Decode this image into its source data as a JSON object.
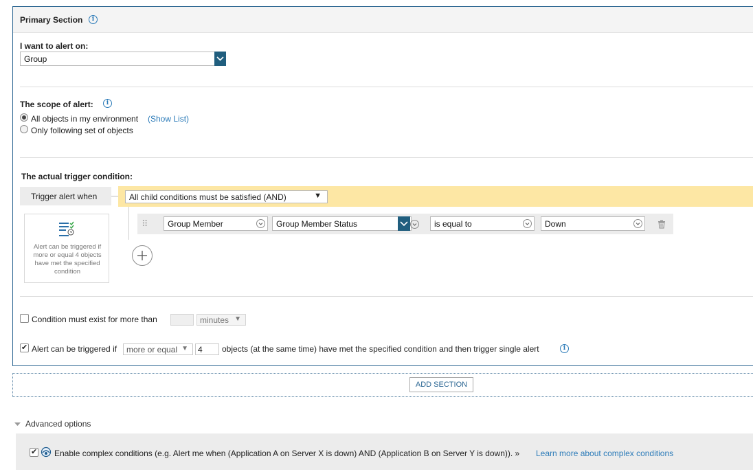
{
  "primary_section": {
    "title": "Primary Section",
    "alert_on": {
      "label": "I want to alert on:",
      "value": "Group"
    },
    "scope": {
      "label": "The scope of alert:",
      "option_all": "All objects in my environment",
      "show_list": "(Show List)",
      "option_following": "Only following set of objects",
      "selected": "All objects in my environment"
    },
    "trigger": {
      "label": "The actual trigger condition:",
      "trigger_when": "Trigger alert when",
      "logic_value": "All child conditions must be satisfied (AND)",
      "condition": {
        "object": "Group Member",
        "field": "Group Member Status",
        "operator": "is equal to",
        "value": "Down"
      },
      "summary_card": "Alert can be triggered if more or equal 4 objects have met the specified condition"
    },
    "condition_exists": {
      "checked": false,
      "label": "Condition must exist for more than",
      "duration_value": "",
      "unit": "minutes"
    },
    "alert_triggered": {
      "checked": true,
      "label_prefix": "Alert can be triggered if",
      "comparison": "more or equal",
      "count": "4",
      "label_suffix": "objects (at the same time) have met the specified condition and then trigger single alert"
    }
  },
  "add_section_label": "ADD SECTION",
  "advanced": {
    "label": "Advanced options",
    "complex_checked": true,
    "complex_text": "Enable complex conditions (e.g. Alert me when (Application A on Server X is down) AND (Application B on Server Y is down)). »",
    "learn_more": "Learn more about complex conditions"
  },
  "colors": {
    "border_blue": "#2b6591",
    "dropdown_accent": "#205e7e",
    "link": "#2a7ab8",
    "trigger_bar": "#fde7a4"
  }
}
